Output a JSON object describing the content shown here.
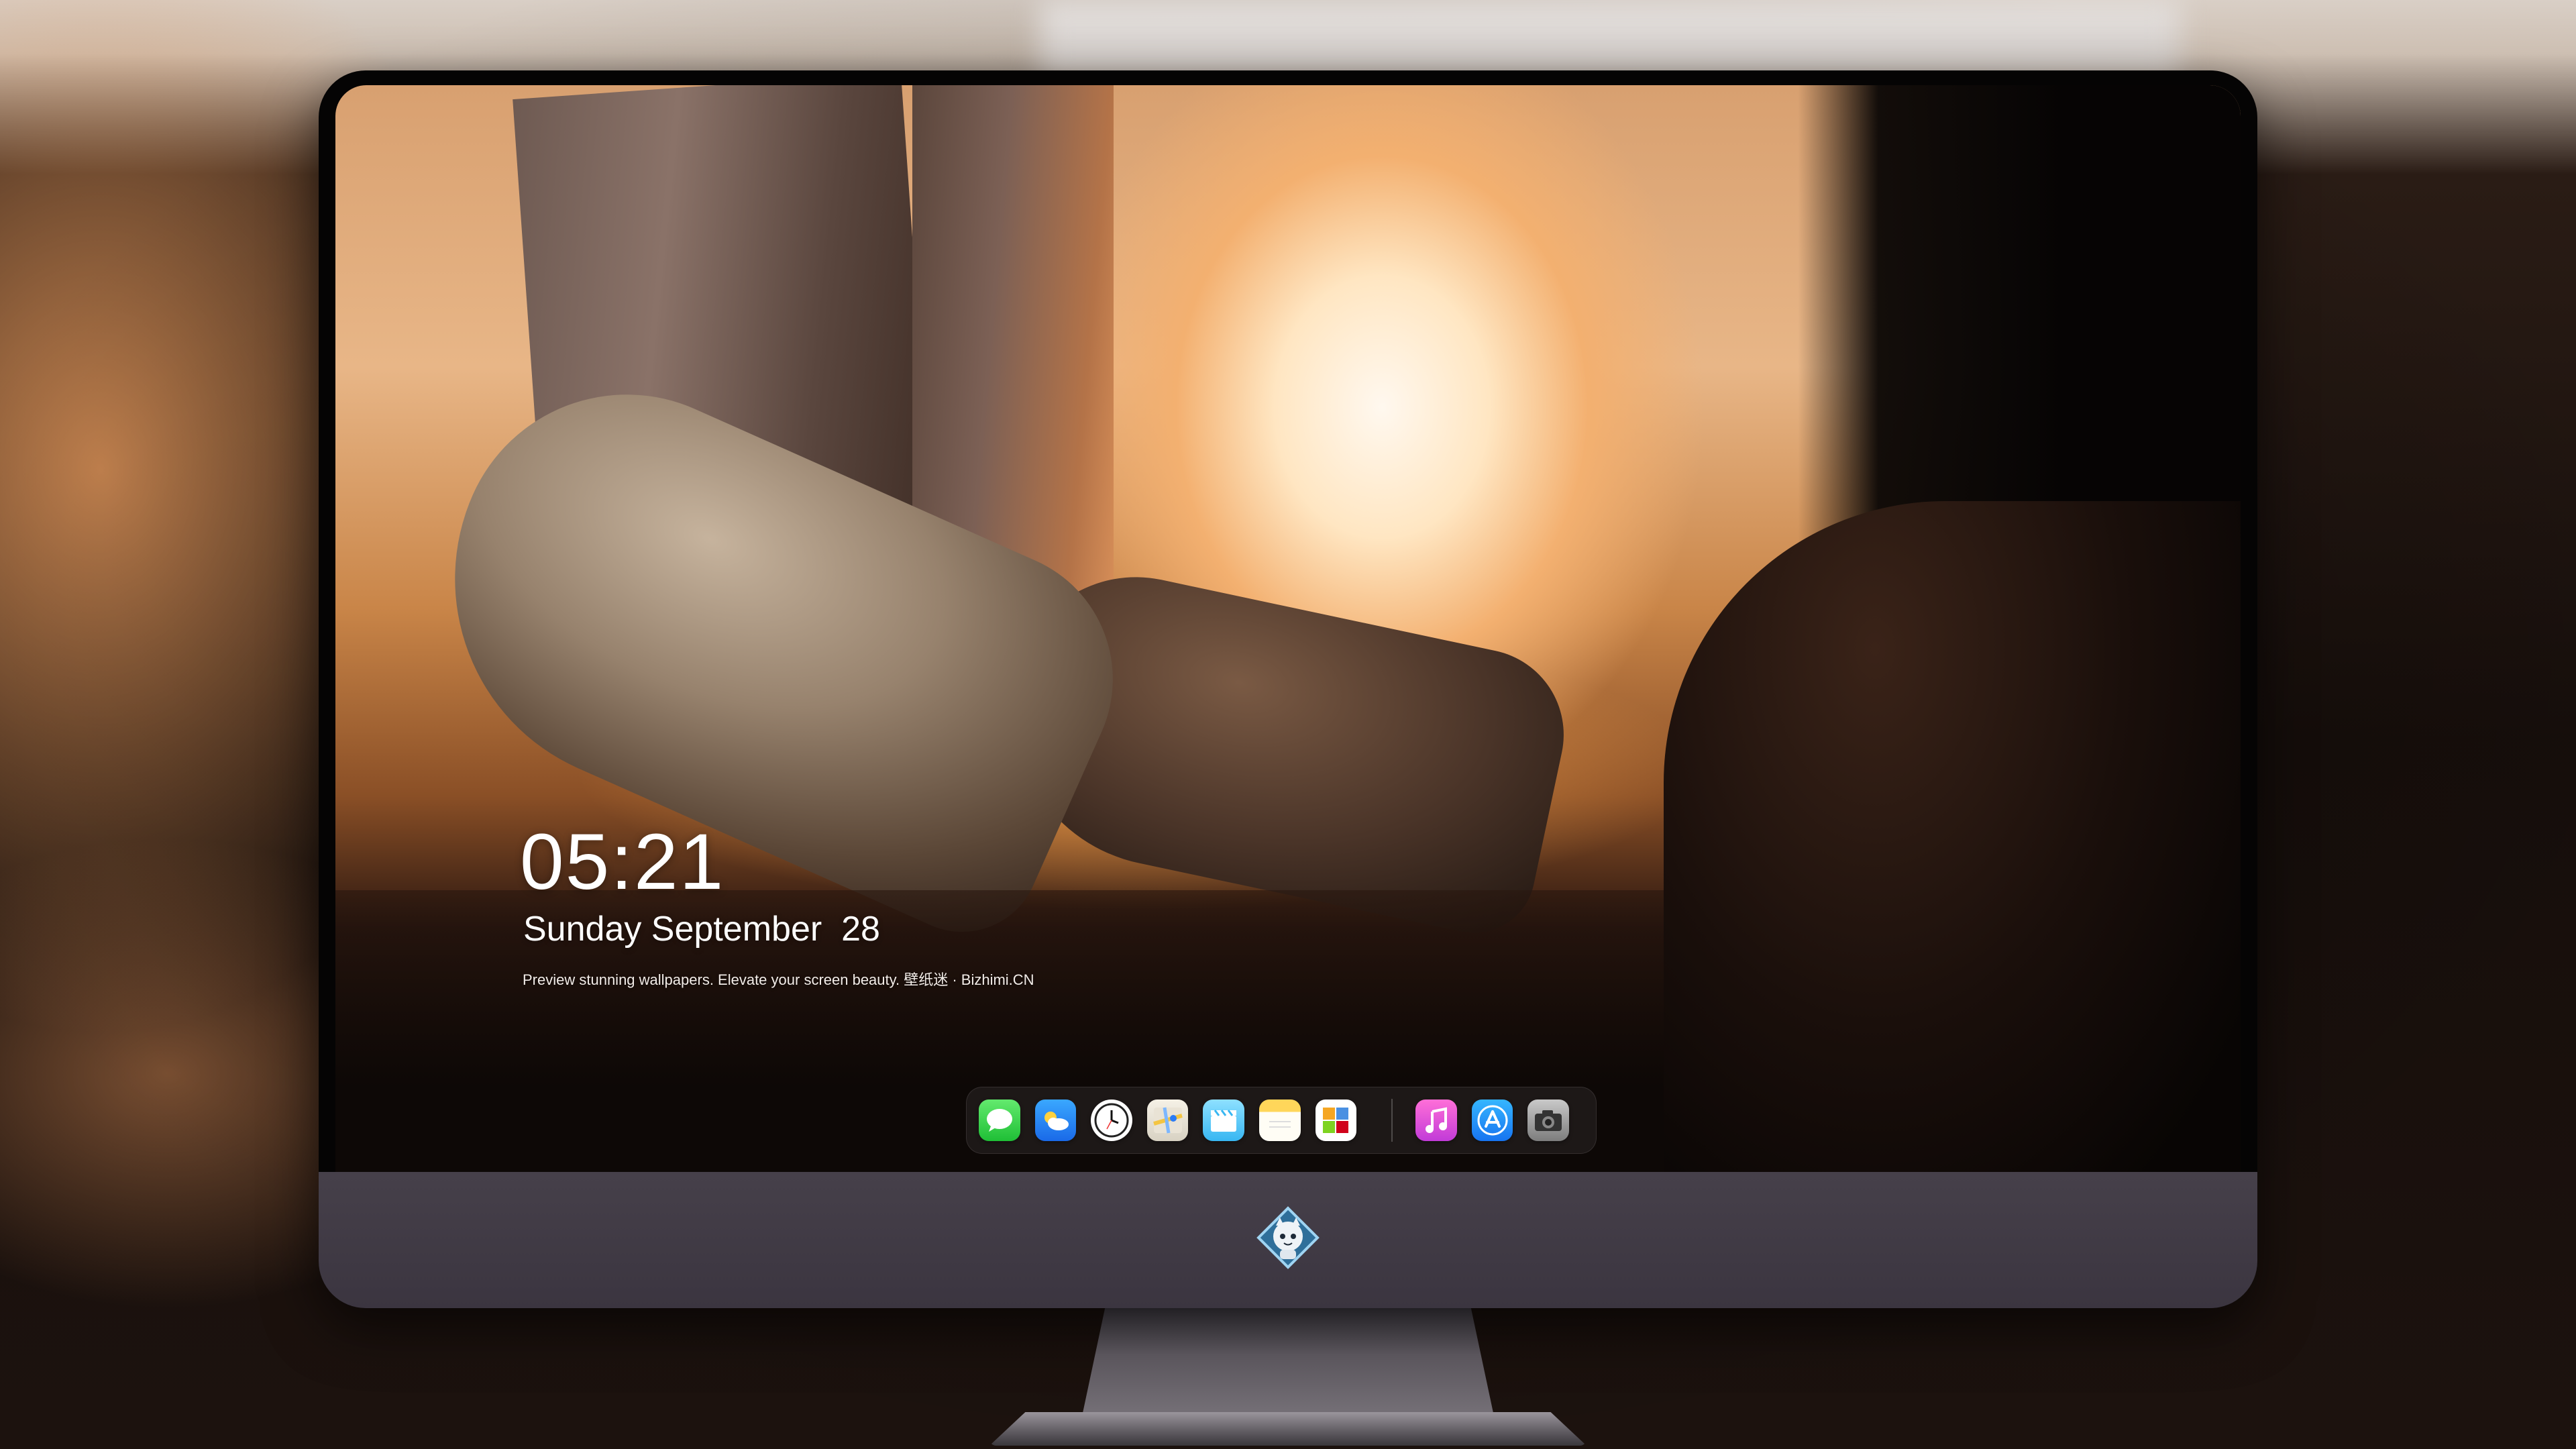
{
  "lockscreen": {
    "time": "05:21",
    "date": "Sunday September  28",
    "tagline": "Preview stunning wallpapers. Elevate your screen beauty. 壁纸迷 · Bizhimi.CN"
  },
  "dock": {
    "apps": [
      {
        "name": "messages-icon"
      },
      {
        "name": "weather-icon"
      },
      {
        "name": "clock-icon"
      },
      {
        "name": "maps-icon"
      },
      {
        "name": "clips-icon"
      },
      {
        "name": "notes-icon"
      },
      {
        "name": "photos-icon"
      },
      {
        "name": "music-icon"
      },
      {
        "name": "app-store-icon"
      },
      {
        "name": "camera-icon"
      }
    ]
  },
  "colors": {
    "accent_warm": "#f3b070",
    "chin": "#433d47"
  }
}
